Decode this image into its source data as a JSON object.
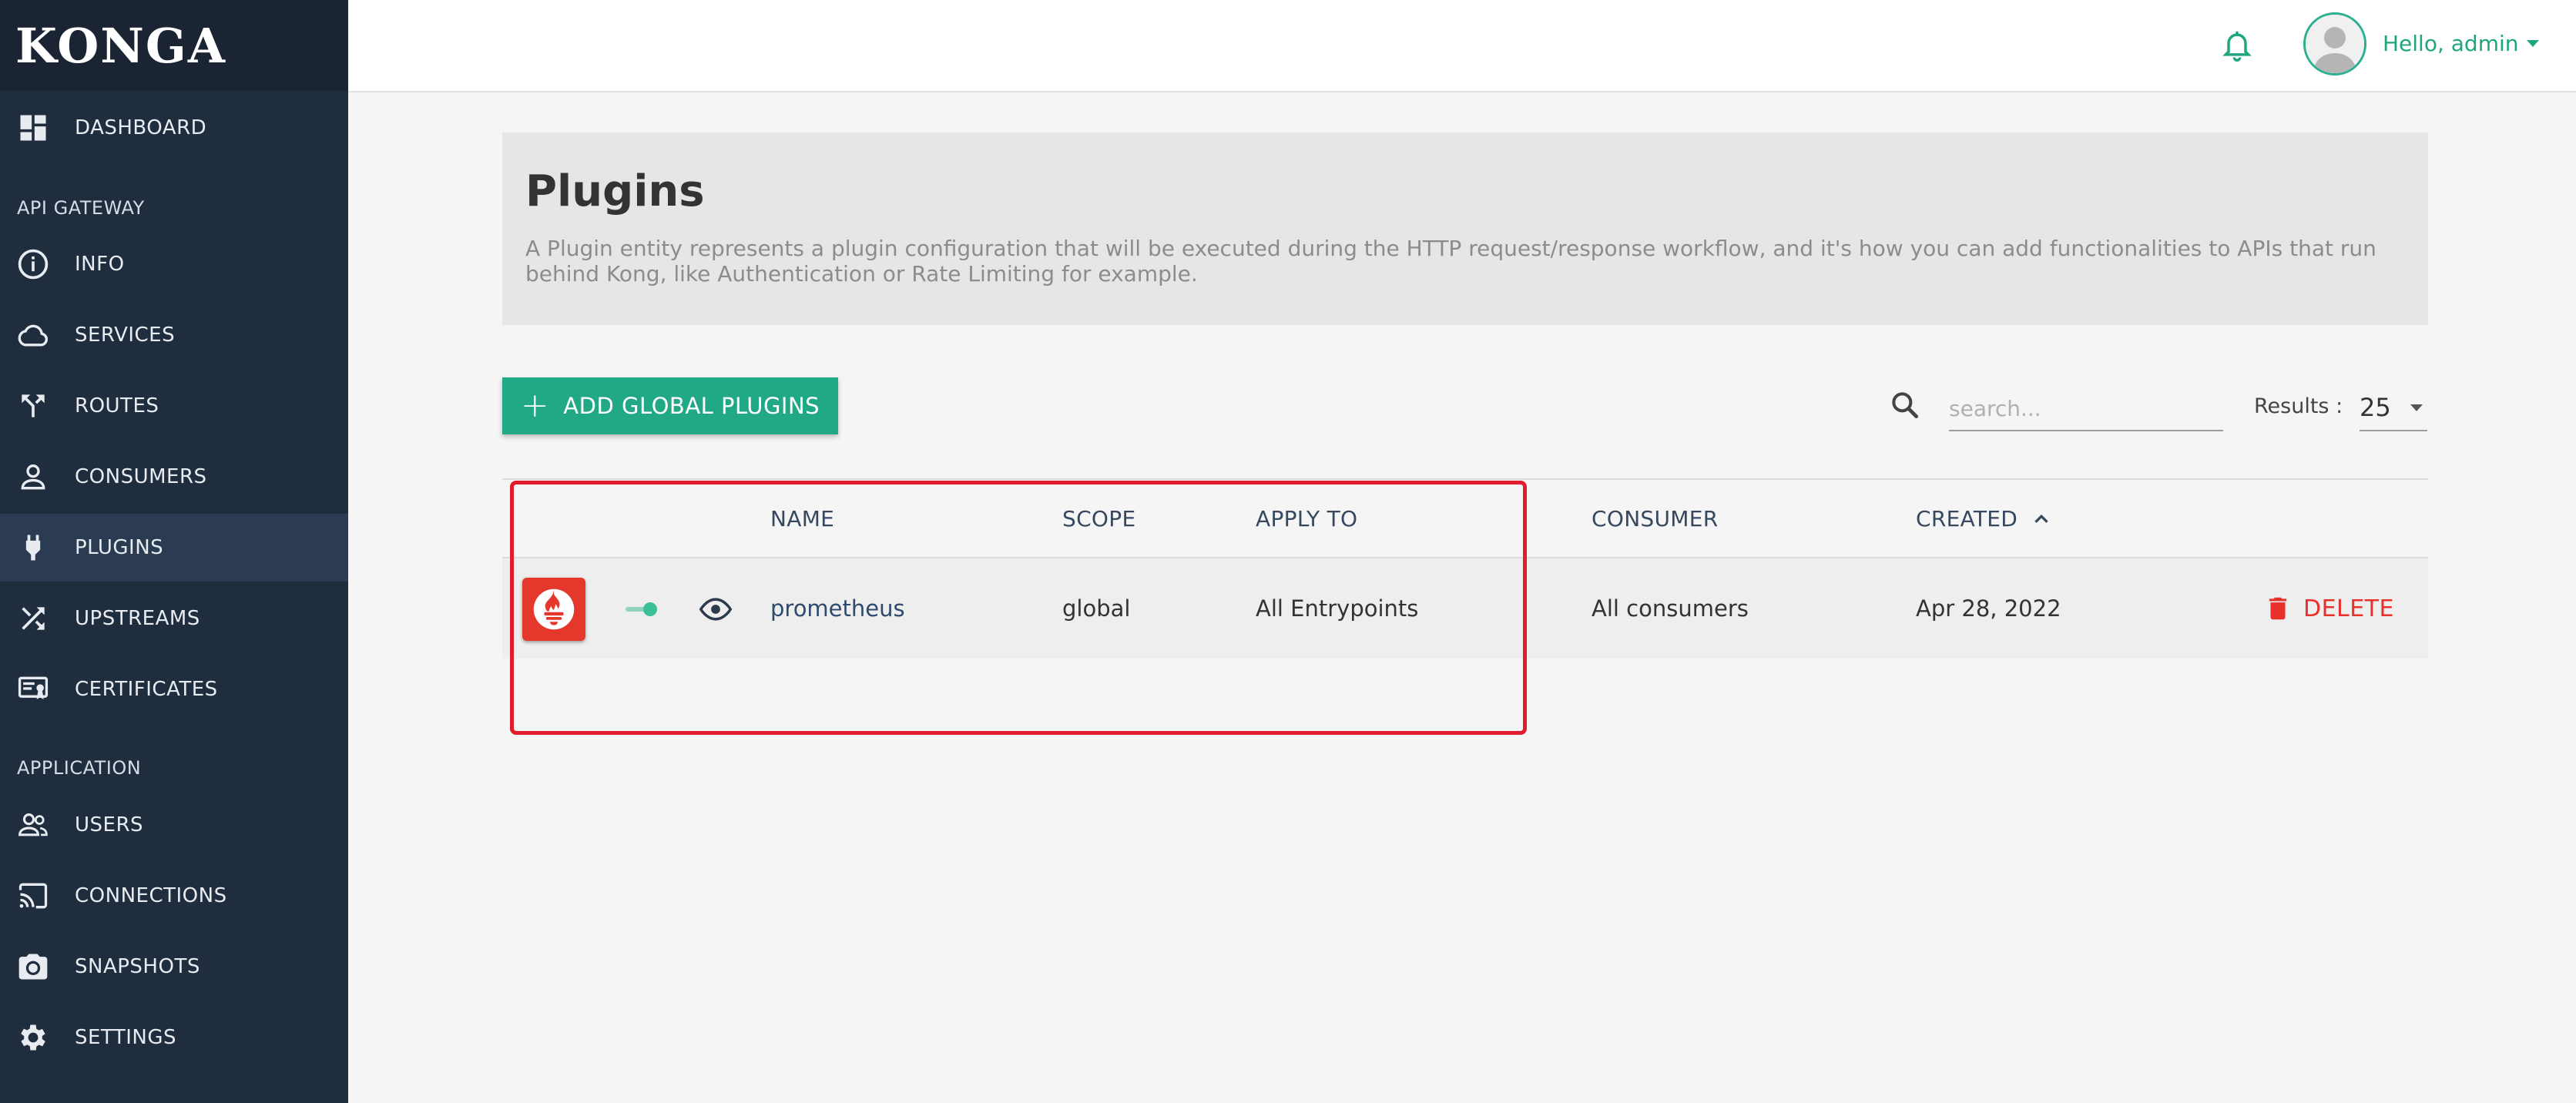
{
  "brand": "KONGA",
  "sidebar": {
    "dashboard": "DASHBOARD",
    "section_api_gateway": "API GATEWAY",
    "info": "INFO",
    "services": "SERVICES",
    "routes": "ROUTES",
    "consumers": "CONSUMERS",
    "plugins": "PLUGINS",
    "upstreams": "UPSTREAMS",
    "certificates": "CERTIFICATES",
    "section_application": "APPLICATION",
    "users": "USERS",
    "connections": "CONNECTIONS",
    "snapshots": "SNAPSHOTS",
    "settings": "SETTINGS",
    "active_item": "plugins"
  },
  "topbar": {
    "user_greeting": "Hello, admin"
  },
  "header": {
    "title": "Plugins",
    "description": "A Plugin entity represents a plugin configuration that will be executed during the HTTP request/response workflow, and it's how you can add functionalities to APIs that run behind Kong, like Authentication or Rate Limiting for example."
  },
  "toolbar": {
    "add_button_label": "ADD GLOBAL PLUGINS",
    "search_placeholder": "search...",
    "results_label": "Results :",
    "results_value": "25"
  },
  "table": {
    "columns": {
      "name": "NAME",
      "scope": "SCOPE",
      "apply_to": "APPLY TO",
      "consumer": "CONSUMER",
      "created": "CREATED"
    },
    "sort": {
      "column": "created",
      "direction": "ascending"
    },
    "rows": [
      {
        "name": "prometheus",
        "scope": "global",
        "apply_to": "All Entrypoints",
        "consumer": "All consumers",
        "created": "Apr 28, 2022",
        "enabled": true,
        "delete_label": "DELETE"
      }
    ]
  },
  "colors": {
    "sidebar_bg": "#202d3e",
    "accent_green": "#21a885",
    "danger_red": "#e8312b",
    "highlight_red": "#e21c2c"
  },
  "icons": {
    "dashboard": "dashboard-icon",
    "info": "info-icon",
    "services": "cloud-icon",
    "routes": "routes-icon",
    "consumers": "person-icon",
    "plugins": "plug-icon",
    "upstreams": "shuffle-icon",
    "certificates": "certificate-icon",
    "users": "users-icon",
    "connections": "cast-icon",
    "snapshots": "camera-icon",
    "settings": "gear-icon"
  }
}
